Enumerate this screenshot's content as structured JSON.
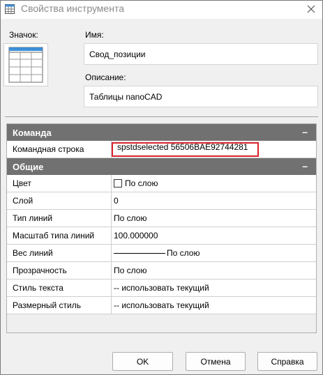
{
  "window": {
    "title": "Свойства инструмента",
    "close_icon": "close-icon"
  },
  "form": {
    "icon_label": "Значок:",
    "name_label": "Имя:",
    "name_value": "Свод_позиции",
    "description_label": "Описание:",
    "description_value": "Таблицы nanoCAD"
  },
  "sections": [
    {
      "title": "Команда",
      "collapse_glyph": "–",
      "rows": [
        {
          "name": "Командная строка",
          "value": "spstdselected 56506BAE92744281"
        }
      ]
    },
    {
      "title": "Общие",
      "collapse_glyph": "–",
      "rows": [
        {
          "name": "Цвет",
          "value": "По слою"
        },
        {
          "name": "Слой",
          "value": "0"
        },
        {
          "name": "Тип линий",
          "value": "По слою"
        },
        {
          "name": "Масштаб типа линий",
          "value": "100.000000"
        },
        {
          "name": "Вес линий",
          "value": "По слою"
        },
        {
          "name": "Прозрачность",
          "value": "По слою"
        },
        {
          "name": "Стиль текста",
          "value": "-- использовать текущий"
        },
        {
          "name": "Размерный стиль",
          "value": "-- использовать текущий"
        }
      ]
    }
  ],
  "buttons": {
    "ok": "OK",
    "cancel": "Отмена",
    "help": "Справка"
  },
  "colors": {
    "section_header": "#717171",
    "highlight_border": "#d9232b",
    "table_icon_header": "#3d8fd6"
  }
}
